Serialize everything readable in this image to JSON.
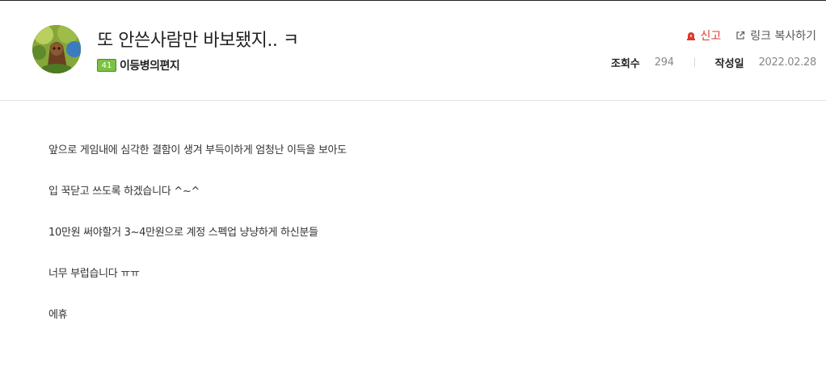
{
  "post": {
    "title": "또 안쓴사람만 바보됐지.. ㅋ",
    "author": {
      "level": "41",
      "name": "이등병의편지"
    },
    "actions": {
      "report": "신고",
      "copy_link": "링크 복사하기"
    },
    "stats": {
      "views_label": "조회수",
      "views_value": "294",
      "date_label": "작성일",
      "date_value": "2022.02.28"
    },
    "body": [
      "앞으로 게임내에 심각한 결함이 생겨 부득이하게 엄청난 이득을 보아도",
      "입 꾹닫고 쓰도록 하겠습니다 ^~^",
      "10만원 써야할거 3~4만원으로 계정 스펙업 냥냥하게 하신분들",
      "너무 부럽습니다 ㅠㅠ",
      "에휴"
    ]
  },
  "icons": {
    "report": "siren-icon",
    "copy_link": "external-link-icon"
  },
  "colors": {
    "report": "#e2372b",
    "level_badge": "#7cc144"
  }
}
